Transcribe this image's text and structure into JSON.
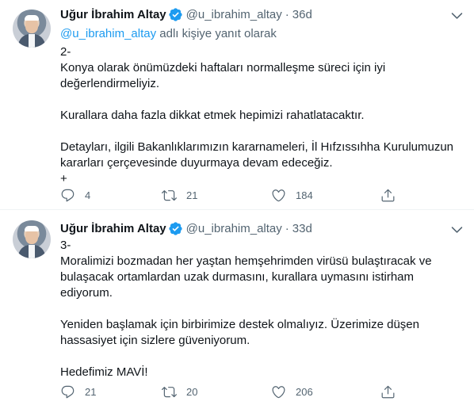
{
  "tweets": [
    {
      "name": "Uğur İbrahim Altay",
      "handle": "@u_ibrahim_altay",
      "separator": "·",
      "time": "36d",
      "reply_mention": "@u_ibrahim_altay",
      "reply_suffix": " adlı kişiye yanıt olarak",
      "paragraphs": [
        "2-\nKonya olarak önümüzdeki haftaları normalleşme süreci için iyi değerlendirmeliyiz.",
        "Kurallara daha fazla dikkat etmek hepimizi rahatlatacaktır.",
        "Detayları, ilgili Bakanlıklarımızın kararnameleri, İl Hıfzıssıhha Kurulumuzun kararları çerçevesinde duyurmaya devam edeceğiz.\n+"
      ],
      "replies": "4",
      "retweets": "21",
      "likes": "184"
    },
    {
      "name": "Uğur İbrahim Altay",
      "handle": "@u_ibrahim_altay",
      "separator": "·",
      "time": "33d",
      "paragraphs": [
        "3-\nMoralimizi bozmadan her yaştan hemşehrimden virüsü bulaştıracak ve bulaşacak ortamlardan uzak durmasını, kurallara uymasını istirham ediyorum.",
        "Yeniden başlamak için birbirimize destek olmalıyız. Üzerimize düşen hassasiyet için sizlere güveniyorum.",
        "Hedefimiz MAVİ!"
      ],
      "replies": "21",
      "retweets": "20",
      "likes": "206"
    }
  ],
  "icons": {
    "verified": "verified-badge-icon",
    "more": "chevron-down-icon",
    "reply": "reply-icon",
    "retweet": "retweet-icon",
    "like": "heart-icon",
    "share": "share-icon"
  },
  "colors": {
    "accent": "#1d9bf0",
    "text": "#0f1419",
    "secondary": "#536471",
    "divider": "#eff3f4"
  }
}
